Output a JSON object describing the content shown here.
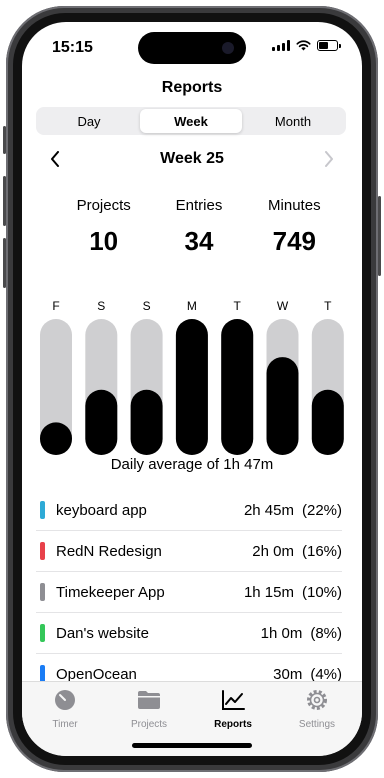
{
  "status": {
    "time": "15:15"
  },
  "header": {
    "title": "Reports"
  },
  "segments": [
    {
      "label": "Day",
      "active": false
    },
    {
      "label": "Week",
      "active": true
    },
    {
      "label": "Month",
      "active": false
    }
  ],
  "week_nav": {
    "label": "Week 25"
  },
  "stats": [
    {
      "label": "Projects",
      "value": "10"
    },
    {
      "label": "Entries",
      "value": "34"
    },
    {
      "label": "Minutes",
      "value": "749"
    }
  ],
  "chart_data": {
    "type": "bar",
    "categories": [
      "F",
      "S",
      "S",
      "M",
      "T",
      "W",
      "T"
    ],
    "values": [
      0.24,
      0.48,
      0.48,
      1.0,
      1.0,
      0.72,
      0.48
    ],
    "ylim": [
      0,
      1
    ],
    "colors": {
      "track": "#cfcfd1",
      "fill": "#000000"
    }
  },
  "daily_average": "Daily average of 1h 47m",
  "projects": [
    {
      "name": "keyboard app",
      "time": "2h 45m",
      "percent": "(22%)",
      "color": "#2eaad6"
    },
    {
      "name": "RedN Redesign",
      "time": "2h 0m",
      "percent": "(16%)",
      "color": "#e8414a"
    },
    {
      "name": "Timekeeper App",
      "time": "1h 15m",
      "percent": "(10%)",
      "color": "#8e8e93"
    },
    {
      "name": "Dan's website",
      "time": "1h 0m",
      "percent": "(8%)",
      "color": "#34c759"
    },
    {
      "name": "OpenOcean",
      "time": "30m",
      "percent": "(4%)",
      "color": "#1a7cf5"
    }
  ],
  "tabbar": [
    {
      "label": "Timer",
      "icon": "timer-icon",
      "active": false
    },
    {
      "label": "Projects",
      "icon": "folder-icon",
      "active": false
    },
    {
      "label": "Reports",
      "icon": "chart-icon",
      "active": true
    },
    {
      "label": "Settings",
      "icon": "gear-icon",
      "active": false
    }
  ]
}
